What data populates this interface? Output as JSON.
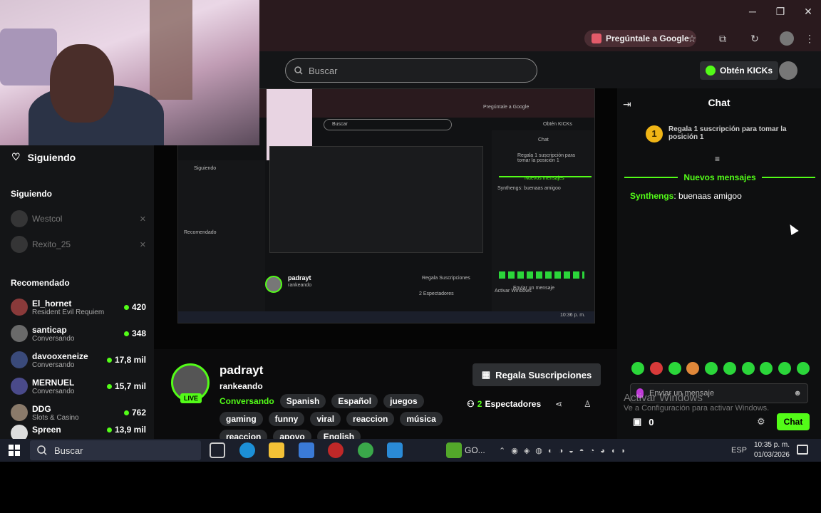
{
  "window": {
    "minimize": "─",
    "restore": "❐",
    "close": "✕"
  },
  "toolbar": {
    "ask_google": "Pregúntale a Google",
    "icons": [
      "star-icon",
      "extensions-icon",
      "history-icon",
      "profile-icon",
      "menu-icon"
    ]
  },
  "header": {
    "search_placeholder": "Buscar",
    "kicks_button": "Obtén KICKs"
  },
  "sidebar": {
    "top_following": "Siguiendo",
    "following_heading": "Siguiendo",
    "following": [
      {
        "name": "Westcol"
      },
      {
        "name": "Rexito_25"
      }
    ],
    "recommended_heading": "Recomendado",
    "recommended": [
      {
        "name": "El_hornet",
        "sub": "Resident Evil Requiem",
        "count": "420"
      },
      {
        "name": "santicap",
        "sub": "Conversando",
        "count": "348"
      },
      {
        "name": "davooxeneize",
        "sub": "Conversando",
        "count": "17,8 mil"
      },
      {
        "name": "MERNUEL",
        "sub": "Conversando",
        "count": "15,7 mil"
      },
      {
        "name": "DDG",
        "sub": "Slots & Casino",
        "count": "762"
      },
      {
        "name": "Spreen",
        "sub": "",
        "count": "13,9 mil"
      }
    ]
  },
  "stream": {
    "streamer": "padrayt",
    "live": "LIVE",
    "title": "rankeando",
    "category": "Conversando",
    "tags_row1": [
      "Spanish",
      "Español",
      "juegos"
    ],
    "tags_row2": [
      "gaming",
      "funny",
      "viral",
      "reaccion",
      "música"
    ],
    "tags_row3": [
      "reaccion",
      "apoyo",
      "English"
    ],
    "gift_button": "Regala Suscripciones",
    "viewers_count": "2",
    "viewers_label": "Espectadores"
  },
  "chat": {
    "title": "Chat",
    "pinned": "Regala 1 suscripción para tomar la posición 1",
    "pinned_rank": "1",
    "new_messages": "Nuevos mensajes",
    "messages": [
      {
        "user": "Synthengs",
        "text": "buenaas amigoo"
      }
    ],
    "input_placeholder": "Enviar un mensaje",
    "count": "0",
    "send": "Chat",
    "activate_title": "Activar Windows",
    "activate_sub": "Ve a Configuración para activar Windows."
  },
  "nested": {
    "search": "Buscar",
    "ask_google": "Pregúntale a Google",
    "kicks": "Obtén KICKs",
    "chat": "Chat",
    "siguiendo": "Siguiendo",
    "new_messages": "Nuevos mensajes",
    "msg": "Synthengs: buenaas amigoo",
    "streamer": "padrayt",
    "title": "rankeando",
    "gift": "Regala Suscripciones",
    "pinned": "Regala 1 suscripción para tomar la posición 1",
    "recomendado": "Recomendado",
    "viewers": "2 Espectadores",
    "activate": "Activar Windows",
    "input": "Enviar un mensaje",
    "clock": "10:36 p. m."
  },
  "taskbar": {
    "search": "Buscar",
    "app_label": "GO...",
    "lang": "ESP",
    "time": "10:35 p. m.",
    "date": "01/03/2026"
  },
  "colors": {
    "accent": "#53fc18",
    "background": "#0b0b0c",
    "chrome": "#2a1a1e"
  }
}
